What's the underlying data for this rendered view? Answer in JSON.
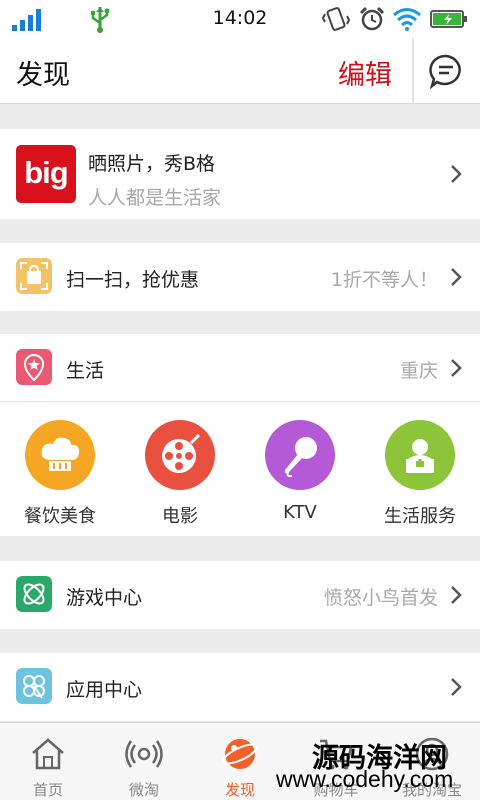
{
  "status_bar": {
    "time": "14:02",
    "icons": [
      "signal-icon",
      "usb-icon",
      "vibrate-icon",
      "alarm-icon",
      "wifi-icon",
      "battery-icon"
    ]
  },
  "header": {
    "title": "发现",
    "edit_label": "编辑",
    "chat_icon": "chat-bubble-icon"
  },
  "big": {
    "logo_text": "big",
    "title": "晒照片，秀B格",
    "subtitle": "人人都是生活家"
  },
  "scan": {
    "label": "扫一扫，抢优惠",
    "right_text": "1折不等人！"
  },
  "life": {
    "label": "生活",
    "right_text": "重庆",
    "categories": [
      {
        "label": "餐饮美食",
        "color": "#f5a623",
        "icon": "chef-hat-icon"
      },
      {
        "label": "电影",
        "color": "#e9503f",
        "icon": "film-reel-icon"
      },
      {
        "label": "KTV",
        "color": "#b45ad6",
        "icon": "microphone-icon"
      },
      {
        "label": "生活服务",
        "color": "#8cc43a",
        "icon": "person-service-icon"
      }
    ]
  },
  "games": {
    "label": "游戏中心",
    "right_text": "愤怒小鸟首发"
  },
  "apps": {
    "label": "应用中心"
  },
  "tabbar": {
    "tabs": [
      {
        "label": "首页",
        "icon": "home-icon"
      },
      {
        "label": "微淘",
        "icon": "broadcast-icon"
      },
      {
        "label": "发现",
        "icon": "planet-icon"
      },
      {
        "label": "购物车",
        "icon": "cart-icon"
      },
      {
        "label": "我的淘宝",
        "icon": "user-icon"
      }
    ]
  },
  "watermark": {
    "line1": "源码海洋网",
    "line2": "www.codehy.com"
  },
  "colors": {
    "accent_red": "#d0101b",
    "background": "#ececec"
  }
}
